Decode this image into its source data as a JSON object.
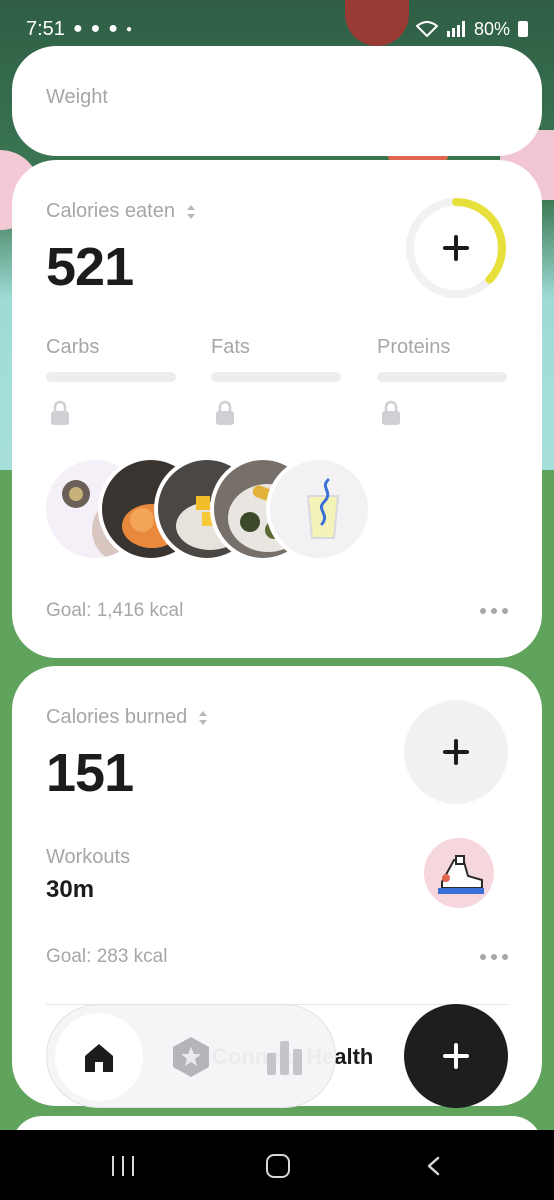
{
  "status_bar": {
    "time": "7:51",
    "battery": "80%"
  },
  "weight_card": {
    "label": "Weight"
  },
  "calories_eaten": {
    "label": "Calories eaten",
    "value": "521",
    "progress_fraction": 0.37,
    "ring_color": "#e8e03a",
    "macros": [
      {
        "label": "Carbs"
      },
      {
        "label": "Fats"
      },
      {
        "label": "Proteins"
      }
    ],
    "meals": [
      "meal-photo-1",
      "meal-photo-2",
      "meal-photo-3",
      "meal-photo-4",
      "drink-icon"
    ],
    "goal": "Goal: 1,416 kcal"
  },
  "calories_burned": {
    "label": "Calories burned",
    "value": "151",
    "workouts_label": "Workouts",
    "workouts_value": "30m",
    "goal": "Goal: 283 kcal",
    "connect_text": "Connect Health"
  },
  "tabs": [
    {
      "name": "home",
      "icon": "home-icon",
      "active": true
    },
    {
      "name": "rank",
      "icon": "badge-icon",
      "active": false
    },
    {
      "name": "stats",
      "icon": "bar-chart-icon",
      "active": false
    }
  ],
  "colors": {
    "background_green": "#5fa35c",
    "card": "#ffffff",
    "fab": "#1e1e1e"
  }
}
